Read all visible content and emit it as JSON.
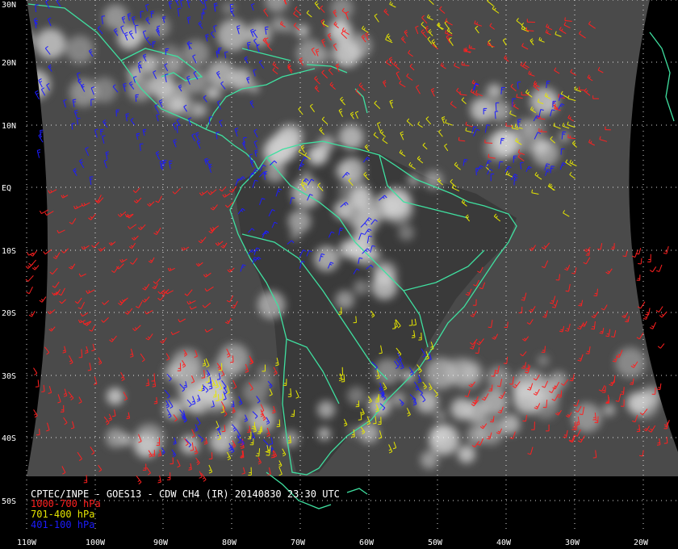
{
  "caption": {
    "title": "CPTEC/INPE - GOES13 - CDW CH4 (IR) 20140830 23:30 UTC"
  },
  "legend": [
    {
      "label": "1000-700 hPa",
      "color": "#ff2020"
    },
    {
      "label": "701-400 hPa",
      "color": "#e6e600"
    },
    {
      "label": "401-100 hPa",
      "color": "#1c1cff"
    }
  ],
  "lat_labels": [
    "30N",
    "20N",
    "10N",
    "EQ",
    "10S",
    "20S",
    "30S",
    "40S",
    "50S"
  ],
  "lon_labels": [
    "110W",
    "100W",
    "90W",
    "80W",
    "70W",
    "60W",
    "50W",
    "40W",
    "30W",
    "20W"
  ],
  "colors": {
    "background": "#000000",
    "coast": "#3fe0a0",
    "grid": "#ffffff",
    "text": "#ffffff"
  }
}
